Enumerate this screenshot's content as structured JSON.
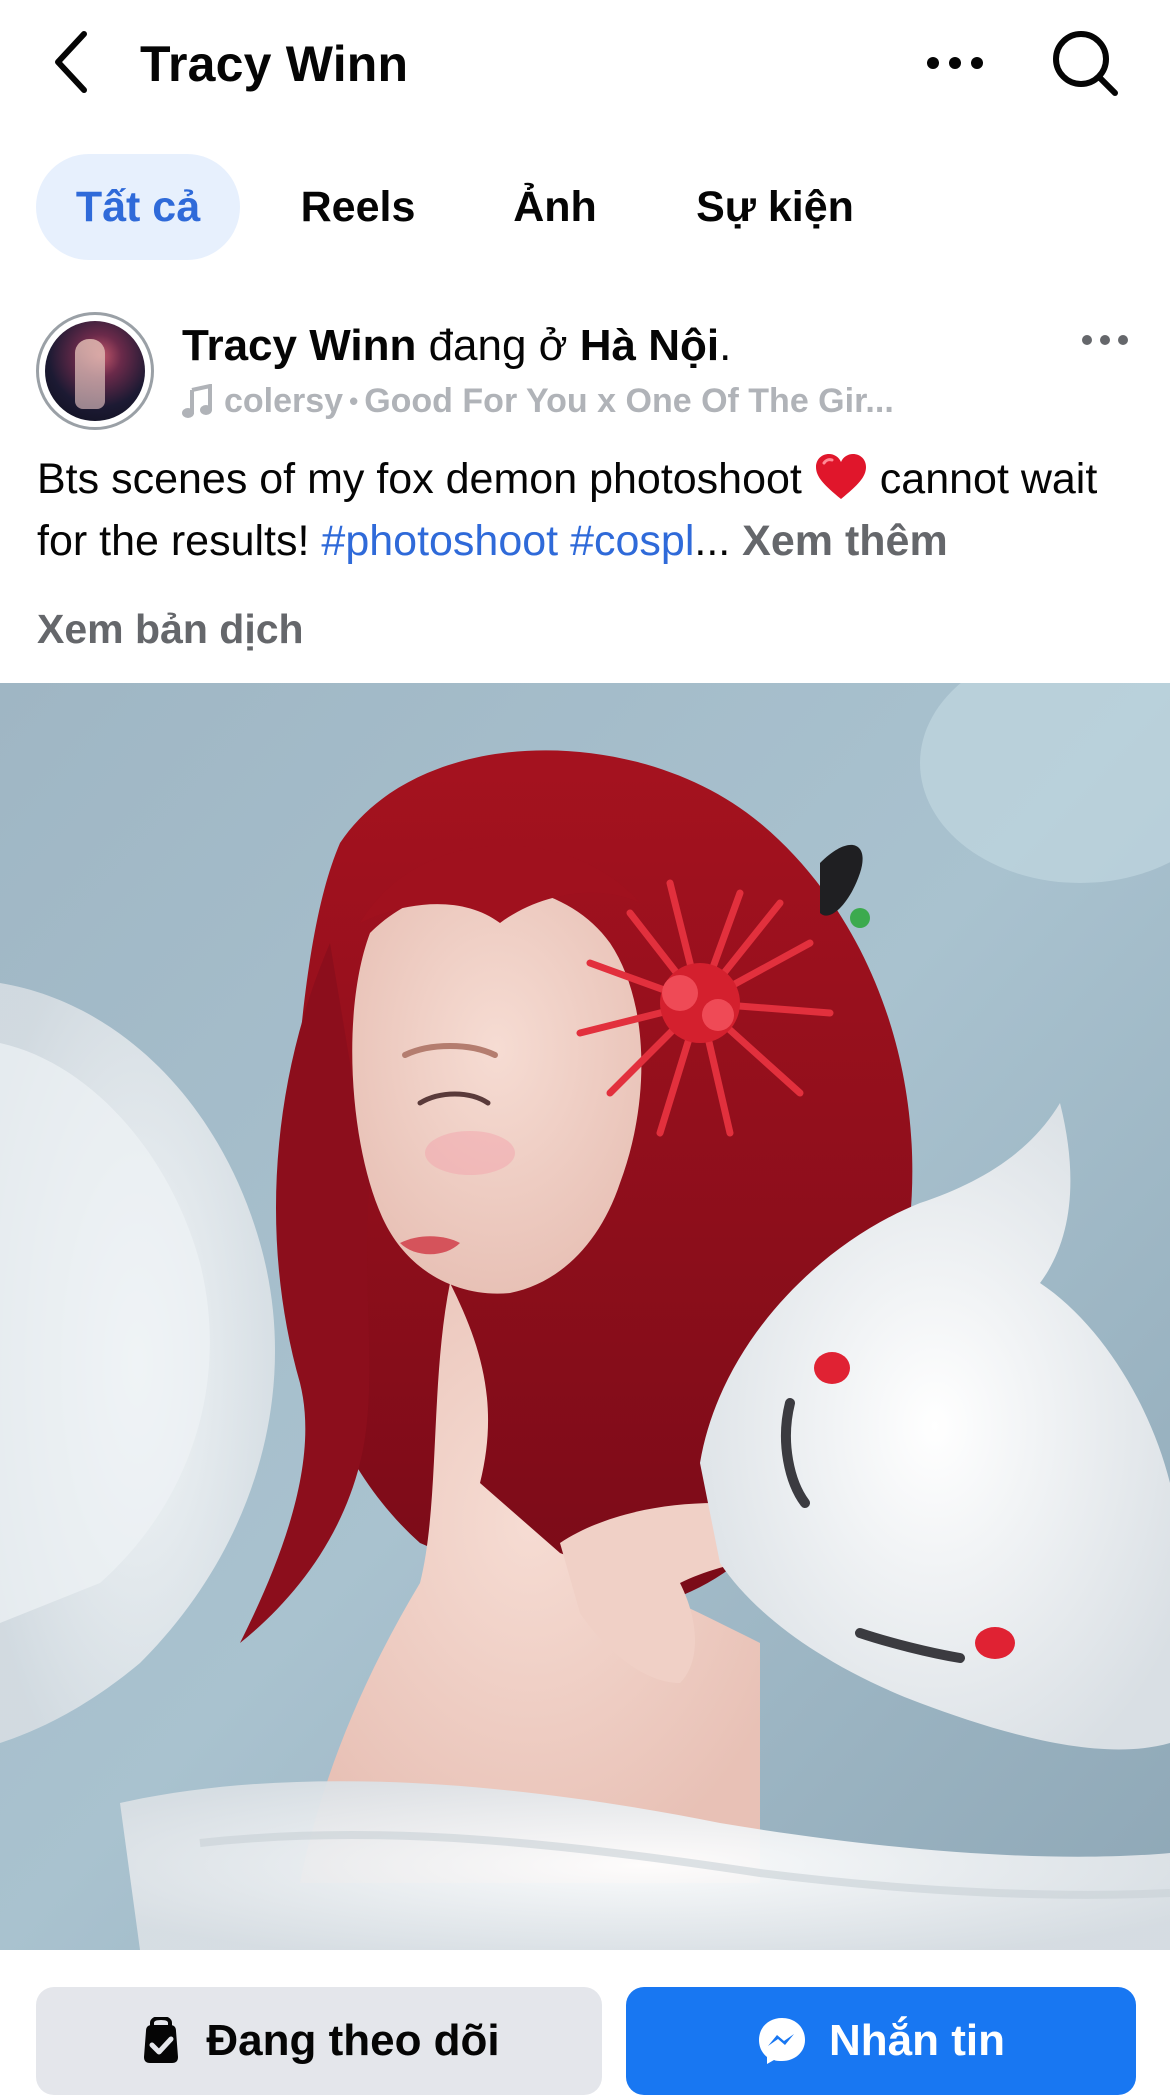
{
  "header": {
    "title": "Tracy Winn",
    "back_icon": "chevron-left-icon",
    "more_icon": "more-horizontal-icon",
    "search_icon": "search-icon"
  },
  "tabs": [
    {
      "label": "Tất cả",
      "active": true
    },
    {
      "label": "Reels",
      "active": false
    },
    {
      "label": "Ảnh",
      "active": false
    },
    {
      "label": "Sự kiện",
      "active": false
    }
  ],
  "post": {
    "author": "Tracy Winn",
    "location_prefix": "đang ở",
    "location": "Hà Nội",
    "location_suffix": ".",
    "music_artist": "colersy",
    "music_sep": "•",
    "music_title": "Good For You x One Of The Gir...",
    "caption_text": "Bts scenes of my fox demon photoshoot",
    "caption_emoji": "❤️",
    "caption_text2": "cannot wait for the results!",
    "hashtag1": "#photoshoot",
    "hashtag2": "#cospl",
    "ellipsis": "...",
    "see_more": "Xem thêm",
    "translate": "Xem bản dịch"
  },
  "actions": {
    "follow_label": "Đang theo dõi",
    "message_label": "Nhắn tin"
  },
  "colors": {
    "accent": "#2f6ad9",
    "tab_active_bg": "#e7f0fd",
    "message_button": "#1877f2",
    "follow_button": "#e4e6eb"
  }
}
